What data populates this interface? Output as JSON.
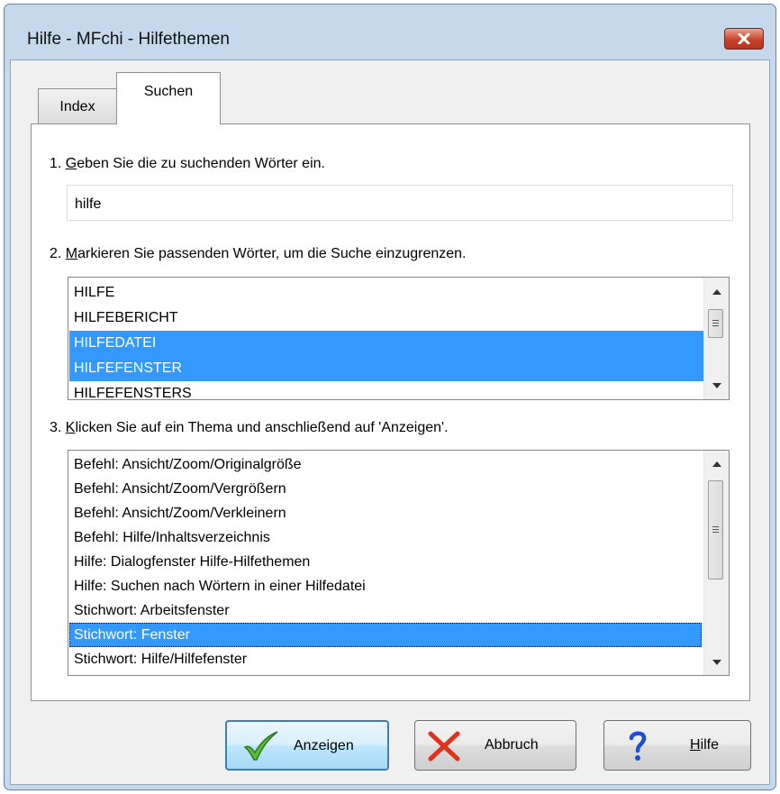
{
  "window": {
    "title": "Hilfe - MFchi - Hilfethemen"
  },
  "tabs": [
    {
      "label": "Index",
      "active": false
    },
    {
      "label": "Suchen",
      "active": true
    }
  ],
  "step1": {
    "number": "1. ",
    "underlined": "G",
    "rest": "eben Sie die zu suchenden Wörter ein.",
    "value": "hilfe"
  },
  "step2": {
    "number": "2. ",
    "underlined": "M",
    "rest": "arkieren Sie passenden Wörter, um die Suche einzugrenzen.",
    "words": [
      {
        "text": "HILFE",
        "selected": false
      },
      {
        "text": "HILFEBERICHT",
        "selected": false
      },
      {
        "text": "HILFEDATEI",
        "selected": true
      },
      {
        "text": "HILFEFENSTER",
        "selected": true
      },
      {
        "text": "HILFEFENSTERS",
        "selected": false
      }
    ]
  },
  "step3": {
    "number": "3. ",
    "underlined": "K",
    "rest": "licken Sie auf ein Thema und anschließend auf 'Anzeigen'.",
    "topics": [
      {
        "text": "Befehl: Ansicht/Zoom/Originalgröße",
        "selected": false
      },
      {
        "text": "Befehl: Ansicht/Zoom/Vergrößern",
        "selected": false
      },
      {
        "text": "Befehl: Ansicht/Zoom/Verkleinern",
        "selected": false
      },
      {
        "text": "Befehl: Hilfe/Inhaltsverzeichnis",
        "selected": false
      },
      {
        "text": "Hilfe: Dialogfenster Hilfe-Hilfethemen",
        "selected": false
      },
      {
        "text": "Hilfe: Suchen nach Wörtern in einer Hilfedatei",
        "selected": false
      },
      {
        "text": "Stichwort: Arbeitsfenster",
        "selected": false
      },
      {
        "text": "Stichwort: Fenster",
        "selected": true
      },
      {
        "text": "Stichwort: Hilfe/Hilfefenster",
        "selected": false
      }
    ]
  },
  "buttons": {
    "show": {
      "label": "Anzeigen",
      "icon": "checkmark-icon"
    },
    "cancel": {
      "label": "Abbruch",
      "icon": "red-x-icon"
    },
    "help": {
      "underlined": "H",
      "rest": "ilfe",
      "icon": "question-mark-icon"
    }
  },
  "colors": {
    "selection": "#3399ff",
    "frame": "#c5d8ec",
    "close_button": "#c9432c"
  }
}
